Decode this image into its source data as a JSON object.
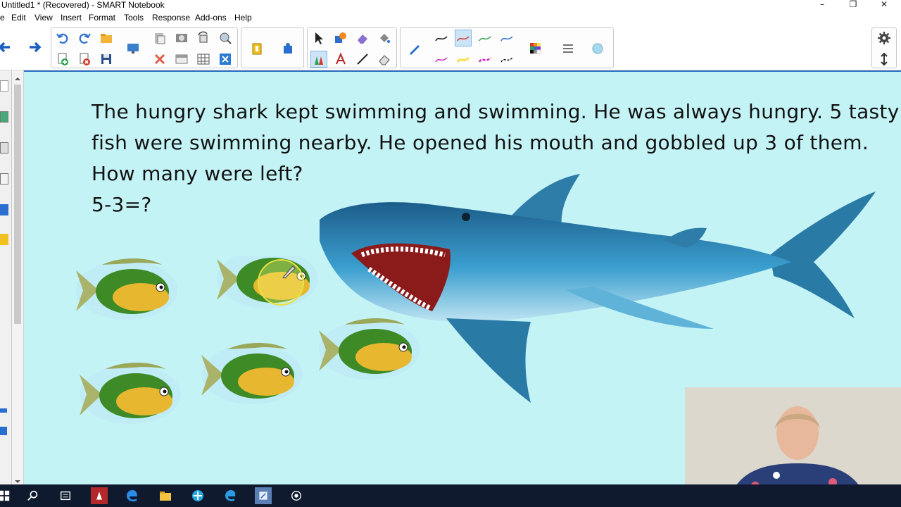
{
  "window": {
    "title": "Untitled1 * (Recovered) - SMART Notebook",
    "minimize": "–",
    "restore": "❐",
    "close": "✕"
  },
  "menu": [
    "e",
    "Edit",
    "View",
    "Insert",
    "Format",
    "Tools",
    "Response",
    "Add-ons",
    "Help"
  ],
  "slide": {
    "story_lines": [
      "The hungry shark kept swimming and swimming. He was always hungry. 5 tasty",
      "fish were swimming nearby. He opened his mouth and gobbled up 3 of them.",
      "How many were left?"
    ],
    "equation": "5-3=?"
  },
  "colors": {
    "canvas_bg": "#c4f3f6",
    "taskbar_bg": "#101a2e",
    "accent": "#2c6fc4"
  },
  "icons": [
    "back-arrow-icon",
    "forward-arrow-icon",
    "undo-icon",
    "redo-icon",
    "open-icon",
    "paste-icon",
    "screenshot-icon",
    "rotate-icon",
    "add-page-icon",
    "delete-page-icon",
    "save-icon",
    "screen-icon",
    "delete-icon",
    "table-icon",
    "close-box-icon",
    "clip-icon",
    "puzzle-icon",
    "select-icon",
    "shapes-icon",
    "eraser-fill-icon",
    "fill-icon",
    "pen-icon",
    "creative-pen-icon",
    "text-icon",
    "line-icon",
    "eraser-icon",
    "magic-pen-icon",
    "color-palette-icon",
    "line-style-icon",
    "transparency-icon",
    "gear-icon",
    "move-toolbar-icon"
  ]
}
